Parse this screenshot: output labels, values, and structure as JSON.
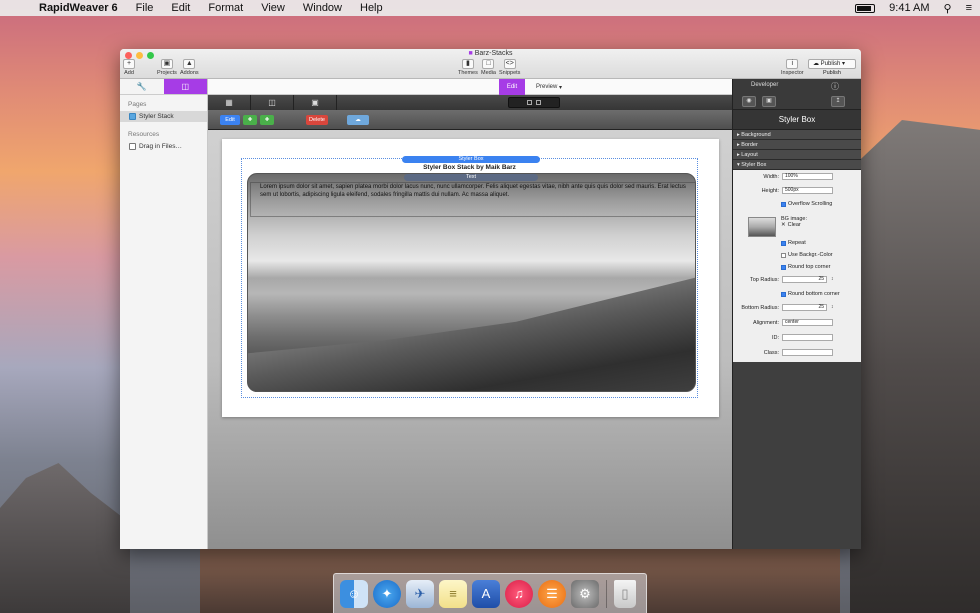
{
  "menubar": {
    "app_name": "RapidWeaver 6",
    "items": [
      "File",
      "Edit",
      "Format",
      "View",
      "Window",
      "Help"
    ],
    "clock": "9:41 AM"
  },
  "window": {
    "title": "Barz-Stacks",
    "toolbar": {
      "add": "Add",
      "projects": "Projects",
      "addons": "Addons",
      "themes": "Themes",
      "media": "Media",
      "snippets": "Snippets",
      "inspector": "Inspector",
      "publish_button": "Publish",
      "publish_label": "Publish"
    }
  },
  "sidebar": {
    "pages_header": "Pages",
    "pages": [
      {
        "label": "Styler Stack"
      }
    ],
    "resources_header": "Resources",
    "resources": [
      {
        "label": "Drag in Files…"
      }
    ]
  },
  "modes": {
    "edit": "Edit",
    "preview": "Preview"
  },
  "stacks_toolbar": {
    "edit": "Edit",
    "delete": "Delete"
  },
  "canvas": {
    "styler_box_tag": "Styler Box",
    "stack_title": "Styler Box Stack by Maik Barz",
    "text_tag": "Text",
    "lorem": "Lorem ipsum dolor sit amet, sapien platea morbi dolor lacus nunc, nunc ullamcorper. Felis aliquet egestas vitae, nibh ante quis quis dolor sed mauris. Erat lectus sem ut lobortis, adipiscing ligula eleifend, sodales fringilla mattis dui nullam. Ac massa aliquet."
  },
  "inspector": {
    "developer": "Developer",
    "title": "Styler Box",
    "sections": [
      "Background",
      "Border",
      "Layout",
      "Styler Box"
    ],
    "form": {
      "width_label": "Width:",
      "width_value": "100%",
      "height_label": "Height:",
      "height_value": "500px",
      "overflow": "Overflow Scrolling",
      "bg_image": "BG image:",
      "clear": "Clear",
      "repeat": "Repeat",
      "use_backgr": "Use Backgr.-Color",
      "round_top": "Round top corner",
      "top_radius_label": "Top Radius:",
      "top_radius_value": "25",
      "round_bottom": "Round bottom corner",
      "bottom_radius_label": "Bottom Radius:",
      "bottom_radius_value": "25",
      "alignment_label": "Alignment:",
      "alignment_value": "center",
      "id_label": "ID:",
      "class_label": "Class:"
    }
  },
  "colors": {
    "accent": "#a63ce6",
    "edit_green": "#4ab04a",
    "delete_red": "#d9463c",
    "blue_tag": "#3b82f0"
  }
}
